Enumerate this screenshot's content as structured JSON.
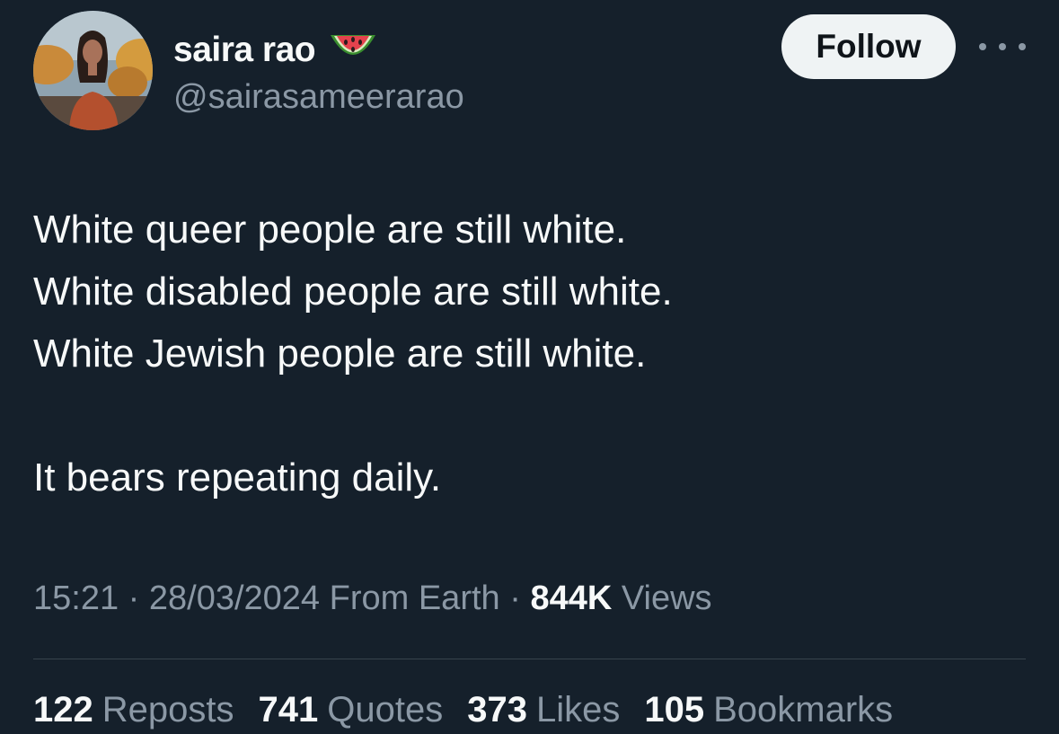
{
  "author": {
    "display_name": "saira rao",
    "handle": "@sairasameerarao",
    "badge_icon": "watermelon-emoji"
  },
  "actions": {
    "follow_label": "Follow",
    "more_icon": "ellipsis-icon"
  },
  "tweet": {
    "lines": [
      "White queer people are still white.",
      "White disabled people are still white.",
      "White Jewish people are still white.",
      "It bears repeating daily."
    ]
  },
  "meta": {
    "time": "15:21",
    "date": "28/03/2024",
    "location": "From Earth",
    "separator": "·",
    "views_count": "844K",
    "views_label": "Views"
  },
  "stats": [
    {
      "count": "122",
      "label": "Reposts"
    },
    {
      "count": "741",
      "label": "Quotes"
    },
    {
      "count": "373",
      "label": "Likes"
    },
    {
      "count": "105",
      "label": "Bookmarks"
    }
  ],
  "colors": {
    "background": "#15202b",
    "text_primary": "#f7f9f9",
    "text_secondary": "#8b98a5",
    "follow_bg": "#eff3f4",
    "divider": "#38444d"
  }
}
